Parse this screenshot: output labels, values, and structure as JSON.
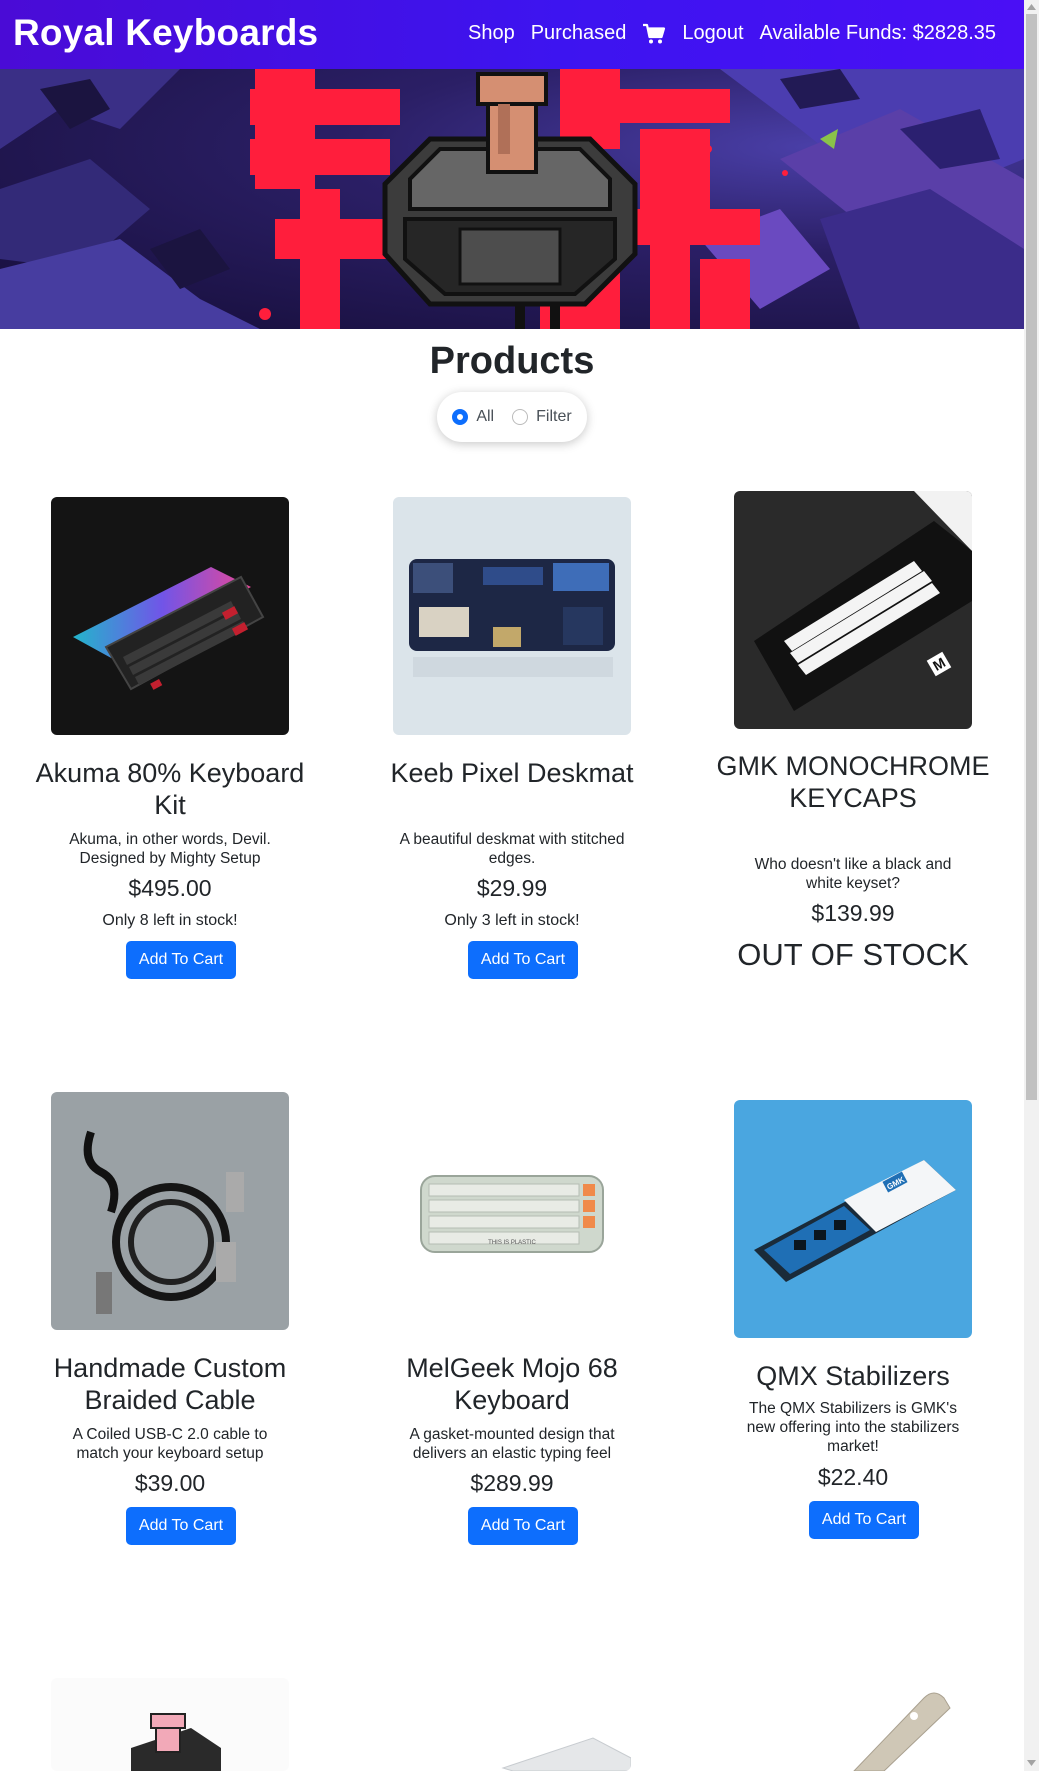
{
  "navbar": {
    "brand": "Royal Keyboards",
    "links": [
      "Shop",
      "Purchased",
      "Logout"
    ],
    "funds": "Available Funds: $2828.35"
  },
  "page": {
    "title": "Products",
    "filter": {
      "all_label": "All",
      "filter_label": "Filter",
      "selected": "All"
    }
  },
  "products": [
    {
      "name": "Akuma 80% Keyboard Kit",
      "desc": "Akuma, in other words, Devil. Designed by Mighty Setup",
      "price": "$495.00",
      "stock": "Only 8 left in stock!",
      "button": "Add To Cart"
    },
    {
      "name": "Keeb Pixel Deskmat",
      "desc": "A beautiful deskmat with stitched edges.",
      "price": "$29.99",
      "stock": "Only 3 left in stock!",
      "button": "Add To Cart"
    },
    {
      "name": "GMK MONOCHROME KEYCAPS",
      "desc": "Who doesn't like a black and white keyset?",
      "price": "$139.99",
      "stock": "OUT OF STOCK"
    },
    {
      "name": "Handmade Custom Braided Cable",
      "desc": "A Coiled USB-C 2.0 cable to match your keyboard setup",
      "price": "$39.00",
      "button": "Add To Cart"
    },
    {
      "name": "MelGeek Mojo 68 Keyboard",
      "desc": "A gasket-mounted design that delivers an elastic typing feel",
      "price": "$289.99",
      "button": "Add To Cart"
    },
    {
      "name": "QMX Stabilizers",
      "desc": "The QMX Stabilizers is GMK's new offering into the stabilizers market!",
      "price": "$22.40",
      "button": "Add To Cart"
    }
  ],
  "images": {
    "keycaps_brand_letter": "M",
    "stabilizer_box_label": "GMK",
    "mojo_print": "THIS IS PLASTIC"
  },
  "colors": {
    "nav_gradient_start": "#4a0bd6",
    "nav_gradient_end": "#3d14f0",
    "button_primary": "#0d6efd",
    "hero_red": "#ff1e3c"
  }
}
